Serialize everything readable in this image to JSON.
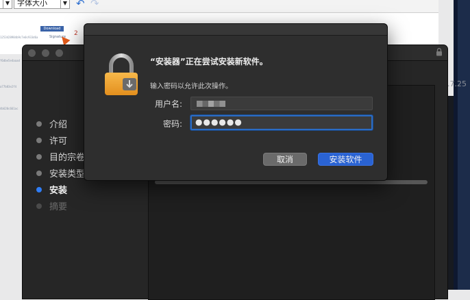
{
  "browser": {
    "font_select_value": "",
    "font_size_select_value": "字体大小",
    "hash_lines": [
      "1253428984b9c7e0c933d6a",
      "f6dbe5e4aaad",
      "a77b83e2f4",
      "4b620c661ac"
    ],
    "download_label": "Download",
    "signature_label": "Signature",
    "badge_number": "2",
    "version_fragment": ".7.25"
  },
  "installer": {
    "steps": [
      {
        "label": "介绍",
        "state": "normal"
      },
      {
        "label": "许可",
        "state": "normal"
      },
      {
        "label": "目的宗卷",
        "state": "normal"
      },
      {
        "label": "安装类型",
        "state": "normal"
      },
      {
        "label": "安装",
        "state": "active"
      },
      {
        "label": "摘要",
        "state": "dim"
      }
    ]
  },
  "dialog": {
    "title": "“安装器”正在尝试安装新软件。",
    "subtitle": "输入密码以允许此次操作。",
    "username_label": "用户名:",
    "password_label": "密码:",
    "password_value": "●●●●●●",
    "cancel_label": "取消",
    "confirm_label": "安装软件"
  },
  "colors": {
    "accent": "#2a63d3",
    "window_bg": "#262626",
    "dialog_bg": "#2e2e2e",
    "padlock": "#f2a33a"
  }
}
